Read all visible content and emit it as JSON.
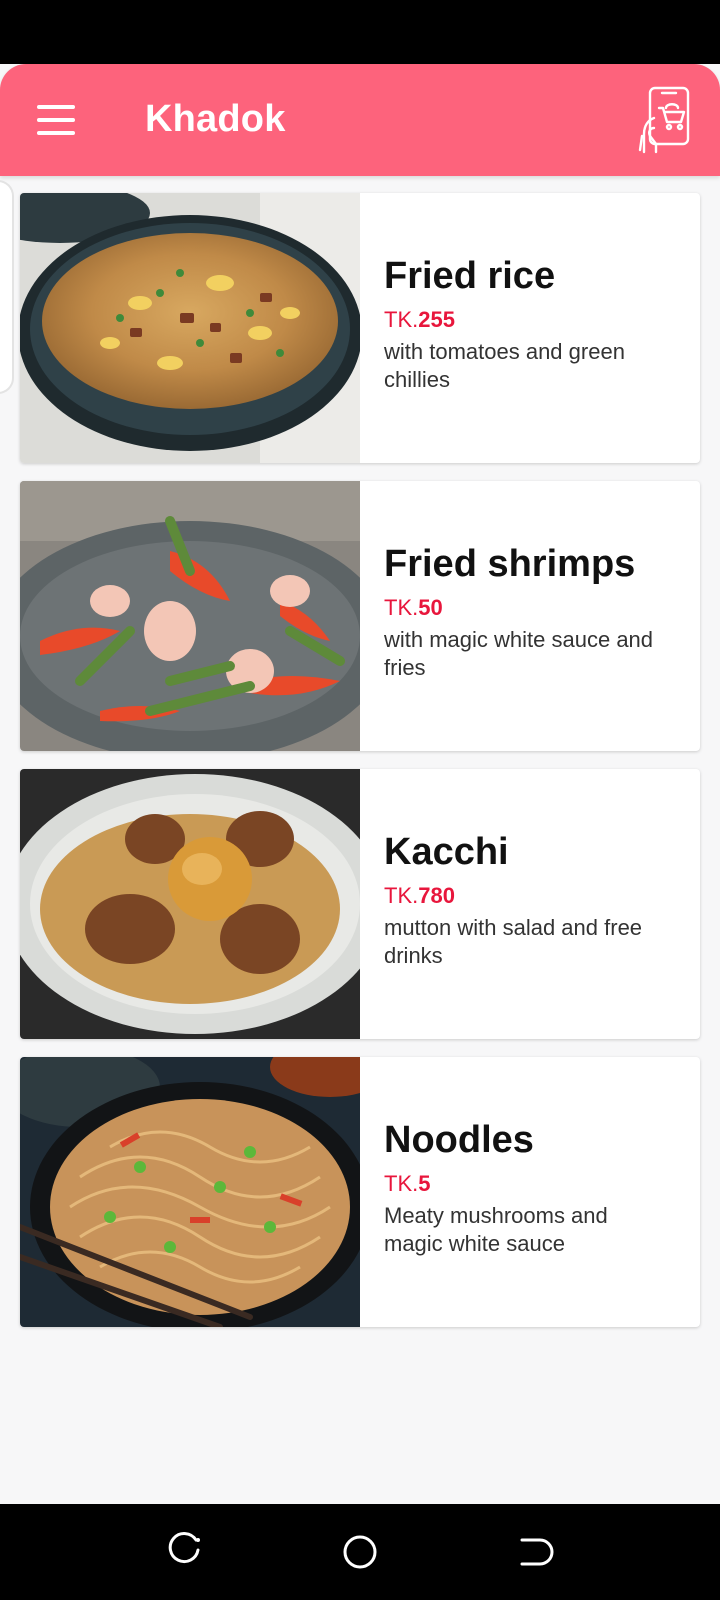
{
  "app": {
    "title": "Khadok"
  },
  "colors": {
    "accent": "#fd637c",
    "price": "#e8163c"
  },
  "icons": {
    "menu": "hamburger-menu-icon",
    "cart": "shopping-cart-phone-icon",
    "recent_apps": "recent-apps-icon",
    "home": "home-icon",
    "back": "back-icon"
  },
  "foods": [
    {
      "name": "Fried rice",
      "price_prefix": "TK.",
      "price": "255",
      "description": "with tomatoes and green chillies"
    },
    {
      "name": "Fried shrimps",
      "price_prefix": "TK.",
      "price": "50",
      "description": "with magic white sauce and fries"
    },
    {
      "name": "Kacchi",
      "price_prefix": "TK.",
      "price": "780",
      "description": "mutton with salad and free drinks"
    },
    {
      "name": "Noodles",
      "price_prefix": "TK.",
      "price": "5",
      "description": "Meaty mushrooms and magic white sauce"
    }
  ]
}
